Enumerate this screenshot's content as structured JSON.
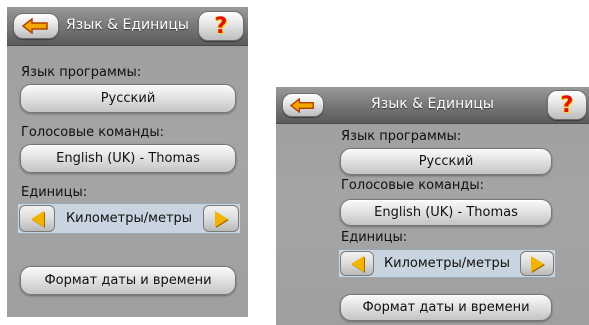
{
  "screens": [
    {
      "title": "Язык & Единицы",
      "help_glyph": "?",
      "program_language_label": "Язык программы:",
      "program_language_value": "Русский",
      "voice_commands_label": "Голосовые команды:",
      "voice_commands_value": "English (UK) - Thomas",
      "units_label": "Единицы:",
      "units_value": "Километры/метры",
      "date_time_button": "Формат даты и времени"
    },
    {
      "title": "Язык & Единицы",
      "help_glyph": "?",
      "program_language_label": "Язык программы:",
      "program_language_value": "Русский",
      "voice_commands_label": "Голосовые команды:",
      "voice_commands_value": "English (UK) - Thomas",
      "units_label": "Единицы:",
      "units_value": "Километры/метры",
      "date_time_button": "Формат даты и времени"
    }
  ],
  "colors": {
    "panel_background": "#a3a3a3",
    "titlebar": "#6f6f6f",
    "selector_background": "#c8d4df",
    "arrow_yellow": "#f2b400",
    "back_arrow": "#f2a800",
    "help_red": "#e01010"
  },
  "icons": {
    "back": "back-arrow-icon",
    "help": "help-question-icon",
    "left": "arrow-left-icon",
    "right": "arrow-right-icon"
  }
}
